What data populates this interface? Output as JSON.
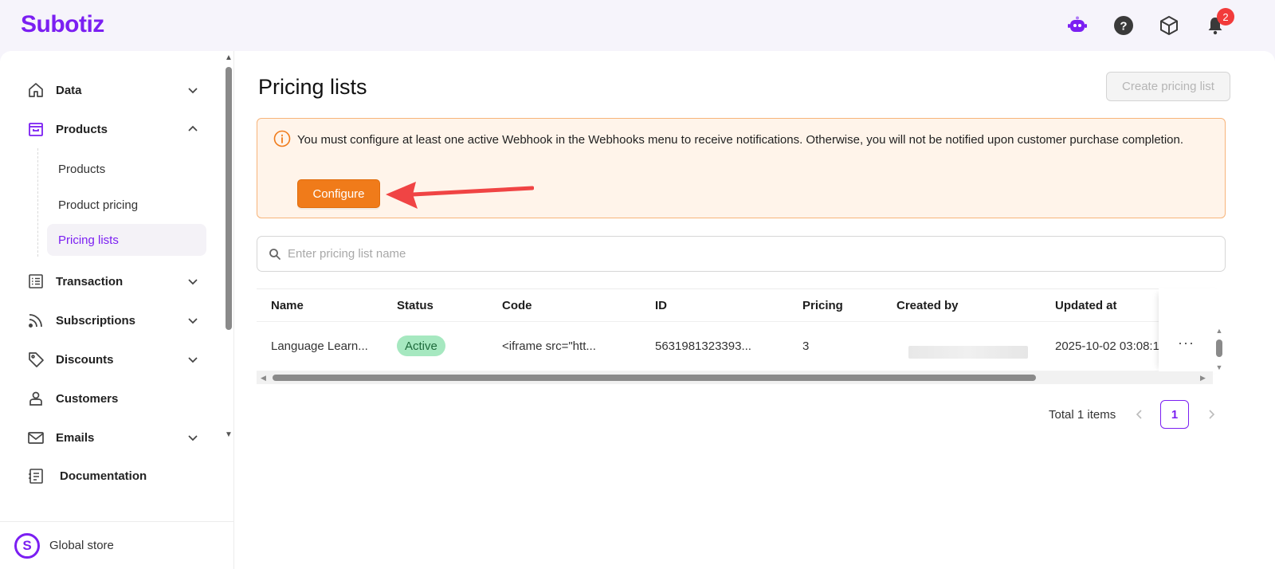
{
  "app": {
    "logo": "Subotiz"
  },
  "header": {
    "icons": [
      "assistant-bot-icon",
      "help-icon",
      "package-icon",
      "bell-icon"
    ],
    "notification_count": "2"
  },
  "sidebar": {
    "items": [
      {
        "label": "Data",
        "icon": "home-icon",
        "expandable": true
      },
      {
        "label": "Products",
        "icon": "shop-icon",
        "expandable": true,
        "expanded": true
      },
      {
        "label": "Transaction",
        "icon": "list-icon",
        "expandable": true
      },
      {
        "label": "Subscriptions",
        "icon": "rss-icon",
        "expandable": true
      },
      {
        "label": "Discounts",
        "icon": "tag-icon",
        "expandable": true
      },
      {
        "label": "Customers",
        "icon": "user-icon",
        "expandable": false
      },
      {
        "label": "Emails",
        "icon": "mail-icon",
        "expandable": true
      },
      {
        "label": "Documentation",
        "icon": "document-icon",
        "expandable": false
      }
    ],
    "sub_items": [
      {
        "label": "Products"
      },
      {
        "label": "Product pricing"
      },
      {
        "label": "Pricing lists",
        "active": true
      }
    ],
    "store": {
      "label": "Global store",
      "icon_letter": "S"
    }
  },
  "main": {
    "title": "Pricing lists",
    "create_button": "Create pricing list",
    "alert": {
      "text": "You must configure at least one active Webhook in the Webhooks menu to receive notifications. Otherwise, you will not be notified upon customer purchase completion.",
      "button": "Configure"
    },
    "search": {
      "placeholder": "Enter pricing list name",
      "value": ""
    },
    "table": {
      "columns": [
        "Name",
        "Status",
        "Code",
        "ID",
        "Pricing",
        "Created by",
        "Updated at"
      ],
      "rows": [
        {
          "name": "Language Learn...",
          "status": "Active",
          "code": "<iframe src=\"htt...",
          "id": "5631981323393...",
          "pricing": "3",
          "created_by": "",
          "updated_at": "2025-10-02 03:08:1",
          "more": "···"
        }
      ]
    },
    "pagination": {
      "total": "Total 1 items",
      "current": "1"
    }
  },
  "colors": {
    "brand": "#7b1ff2",
    "alert_bg": "#fff4ea",
    "alert_border": "#f7b47a",
    "configure_button": "#f07b1a",
    "status_active_bg": "#a6e8c0",
    "annotation_arrow": "#f04444"
  }
}
